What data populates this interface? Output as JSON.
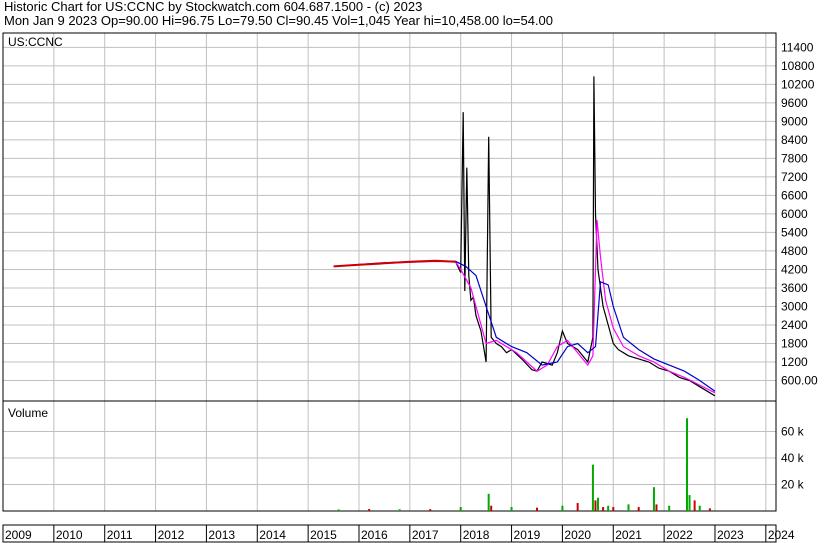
{
  "header": {
    "line1": "Historic Chart for US:CCNC by Stockwatch.com 604.687.1500 - (c) 2023",
    "line2": "Mon Jan  9 2023   Op=90.00   Hi=96.75   Lo=79.50   Cl=90.45   Vol=1,045   Year hi=10,458.00   lo=54.00"
  },
  "chart_data": [
    {
      "type": "line",
      "panel_label": "US:CCNC",
      "y_ticks": [
        "11400",
        "10800",
        "10200",
        "9600",
        "9000",
        "8400",
        "7800",
        "7200",
        "6600",
        "6000",
        "5400",
        "4800",
        "4200",
        "3600",
        "3000",
        "2400",
        "1800",
        "1200",
        "600.00"
      ],
      "ylim": [
        0,
        11800
      ],
      "xlim": [
        2009.0,
        2024.2
      ],
      "colors": {
        "price": "#000000",
        "ma_short": "#ff00ff",
        "ma_long": "#0000cc",
        "early_price": "#cc0000"
      },
      "series": [
        {
          "key": "price",
          "x": [
            2015.5,
            2016.0,
            2016.5,
            2017.0,
            2017.5,
            2017.9,
            2018.0,
            2018.05,
            2018.08,
            2018.12,
            2018.16,
            2018.2,
            2018.25,
            2018.3,
            2018.4,
            2018.5,
            2018.55,
            2018.6,
            2018.7,
            2018.8,
            2018.9,
            2019.0,
            2019.2,
            2019.4,
            2019.5,
            2019.6,
            2019.8,
            2019.9,
            2020.0,
            2020.1,
            2020.3,
            2020.5,
            2020.6,
            2020.62,
            2020.65,
            2020.7,
            2020.75,
            2020.8,
            2020.9,
            2021.0,
            2021.1,
            2021.2,
            2021.3,
            2021.5,
            2021.7,
            2021.9,
            2022.1,
            2022.3,
            2022.5,
            2022.7,
            2022.9,
            2023.0
          ],
          "y": [
            4300,
            4350,
            4400,
            4450,
            4480,
            4450,
            4100,
            9300,
            3500,
            7500,
            4000,
            3200,
            3300,
            2700,
            2200,
            1200,
            8500,
            2000,
            1800,
            1700,
            1500,
            1600,
            1300,
            950,
            900,
            1200,
            1100,
            1500,
            2200,
            1800,
            1600,
            1200,
            2000,
            10458,
            6000,
            4200,
            3600,
            3000,
            2400,
            1800,
            1600,
            1500,
            1400,
            1300,
            1200,
            1000,
            900,
            700,
            600,
            400,
            200,
            100
          ]
        },
        {
          "key": "ma_short",
          "x": [
            2015.5,
            2016.5,
            2017.5,
            2017.9,
            2018.0,
            2018.1,
            2018.2,
            2018.3,
            2018.5,
            2018.7,
            2018.9,
            2019.1,
            2019.3,
            2019.5,
            2019.7,
            2019.9,
            2020.1,
            2020.3,
            2020.5,
            2020.6,
            2020.68,
            2020.75,
            2020.85,
            2021.0,
            2021.2,
            2021.5,
            2021.8,
            2022.1,
            2022.4,
            2022.7,
            2023.0
          ],
          "y": [
            4300,
            4400,
            4460,
            4450,
            4200,
            3900,
            3600,
            3000,
            1800,
            1900,
            1700,
            1500,
            1200,
            900,
            1100,
            1700,
            1900,
            1500,
            1100,
            1400,
            5800,
            4600,
            3200,
            2300,
            1700,
            1400,
            1200,
            900,
            700,
            450,
            200
          ]
        },
        {
          "key": "ma_long",
          "x": [
            2015.5,
            2016.5,
            2017.5,
            2017.9,
            2018.1,
            2018.3,
            2018.5,
            2018.7,
            2019.0,
            2019.3,
            2019.6,
            2019.9,
            2020.1,
            2020.3,
            2020.5,
            2020.65,
            2020.75,
            2020.9,
            2021.0,
            2021.2,
            2021.5,
            2021.8,
            2022.1,
            2022.4,
            2022.7,
            2023.0
          ],
          "y": [
            4300,
            4420,
            4470,
            4460,
            4300,
            4000,
            3000,
            2000,
            1700,
            1500,
            1100,
            1200,
            1700,
            1800,
            1500,
            1700,
            3800,
            3700,
            3000,
            2000,
            1600,
            1300,
            1100,
            900,
            600,
            250
          ]
        }
      ]
    },
    {
      "type": "bar",
      "panel_label": "Volume",
      "y_ticks": [
        "60 k",
        "40 k",
        "20 k"
      ],
      "ylim": [
        0,
        80000
      ],
      "colors": {
        "up": "#00aa00",
        "down": "#cc0000"
      },
      "x": [
        2015.6,
        2016.2,
        2016.8,
        2017.4,
        2018.0,
        2018.55,
        2018.6,
        2019.0,
        2019.5,
        2020.0,
        2020.3,
        2020.6,
        2020.65,
        2020.7,
        2020.8,
        2020.9,
        2021.0,
        2021.3,
        2021.5,
        2021.8,
        2021.85,
        2022.1,
        2022.45,
        2022.5,
        2022.6,
        2022.7,
        2022.9
      ],
      "values": [
        1200,
        1500,
        1300,
        1400,
        3000,
        13000,
        4000,
        3000,
        2500,
        4000,
        6000,
        35000,
        8000,
        10000,
        3000,
        4000,
        3000,
        5000,
        3000,
        18000,
        5000,
        4000,
        70000,
        12000,
        8000,
        4000,
        2000
      ],
      "up": [
        true,
        false,
        true,
        false,
        true,
        true,
        false,
        true,
        false,
        true,
        false,
        true,
        false,
        true,
        false,
        true,
        false,
        true,
        false,
        true,
        false,
        true,
        true,
        true,
        false,
        true,
        false
      ]
    },
    {
      "type": "axis",
      "x_tick_labels": [
        "2009",
        "2010",
        "2011",
        "2012",
        "2013",
        "2014",
        "2015",
        "2016",
        "2017",
        "2018",
        "2019",
        "2020",
        "2021",
        "2022",
        "2023",
        "2024"
      ]
    }
  ]
}
